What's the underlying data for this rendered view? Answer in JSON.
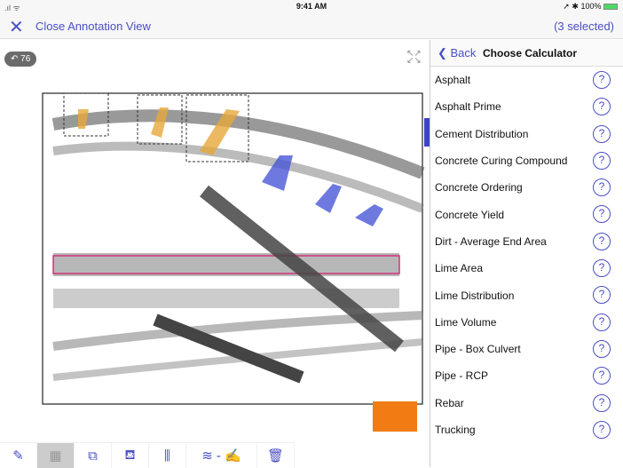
{
  "status": {
    "time": "9:41 AM",
    "battery": "100%"
  },
  "nav": {
    "close_label": "Close Annotation View",
    "selection": "(3 selected)"
  },
  "canvas": {
    "badge": "76"
  },
  "panel": {
    "back": "Back",
    "title": "Choose Calculator",
    "selected": "Cement Distribution",
    "items": [
      "Asphalt",
      "Asphalt Prime",
      "Cement Distribution",
      "Concrete Curing Compound",
      "Concrete Ordering",
      "Concrete Yield",
      "Dirt - Average End Area",
      "Lime Area",
      "Lime Distribution",
      "Lime Volume",
      "Pipe - Box Culvert",
      "Pipe - RCP",
      "Rebar",
      "Trucking"
    ]
  },
  "colors": {
    "accent": "#4a4fc4",
    "orange": "#f07c13",
    "selected_indicator": "#3a44c6"
  },
  "toolbar": {
    "icons": [
      "ruler-icon",
      "calculator-icon",
      "add-copy-icon",
      "paint-bucket-icon",
      "sliders-icon",
      "layers-icon",
      "edit-note-icon",
      "trash-icon"
    ]
  }
}
